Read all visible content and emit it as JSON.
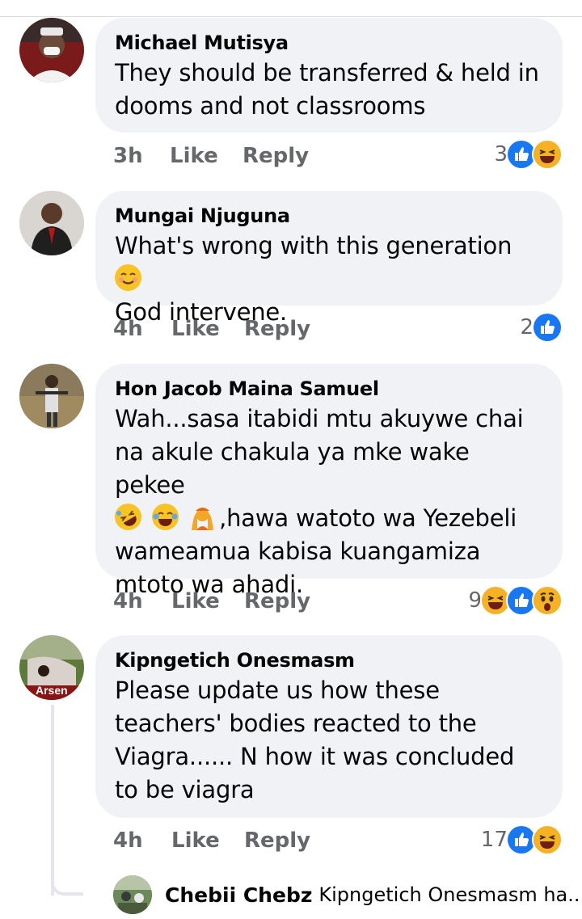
{
  "comments": [
    {
      "author": "Michael Mutisya",
      "text": "They should be transferred & held in dooms and not classrooms",
      "time": "3h",
      "like": "Like",
      "reply": "Reply",
      "reaction_count": "3",
      "reactions": [
        "like-icon",
        "haha-icon"
      ]
    },
    {
      "author": "Mungai Njuguna",
      "text_line1": "What's wrong with this generation",
      "text_line2": "God intervene.",
      "emoji": "smiling-face-icon",
      "time": "4h",
      "like": "Like",
      "reply": "Reply",
      "reaction_count": "2",
      "reactions": [
        "like-icon"
      ]
    },
    {
      "author": "Hon Jacob Maina Samuel",
      "text_line1": "Wah...sasa itabidi mtu akuywe chai",
      "text_line2": "na akule chakula ya mke wake pekee",
      "text_line3": ",hawa watoto wa Yezebeli",
      "text_line4": "wameamua kabisa kuangamiza",
      "text_line5": "mtoto wa ahadi.",
      "emojis": [
        "rolling-laughing-icon",
        "tears-of-joy-icon",
        "person-raising-hands-icon"
      ],
      "time": "4h",
      "like": "Like",
      "reply": "Reply",
      "reaction_count": "9",
      "reactions": [
        "haha-icon",
        "like-icon",
        "wow-icon"
      ]
    },
    {
      "author": "Kipngetich Onesmasm",
      "text": "Please update us how these teachers' bodies reacted to the Viagra...... N how it was concluded to be viagra",
      "avatar_text": "Arsen",
      "time": "4h",
      "like": "Like",
      "reply": "Reply",
      "reaction_count": "17",
      "reactions": [
        "like-icon",
        "haha-icon"
      ]
    }
  ],
  "reply_preview": {
    "author": "Chebii Chebz",
    "text": "Kipngetich Onesmasm ha..."
  },
  "colors": {
    "bubble": "#f0f2f5",
    "meta_text": "#65676b",
    "like_blue": "#1877f2",
    "haha_yellow": "#f7b125"
  }
}
